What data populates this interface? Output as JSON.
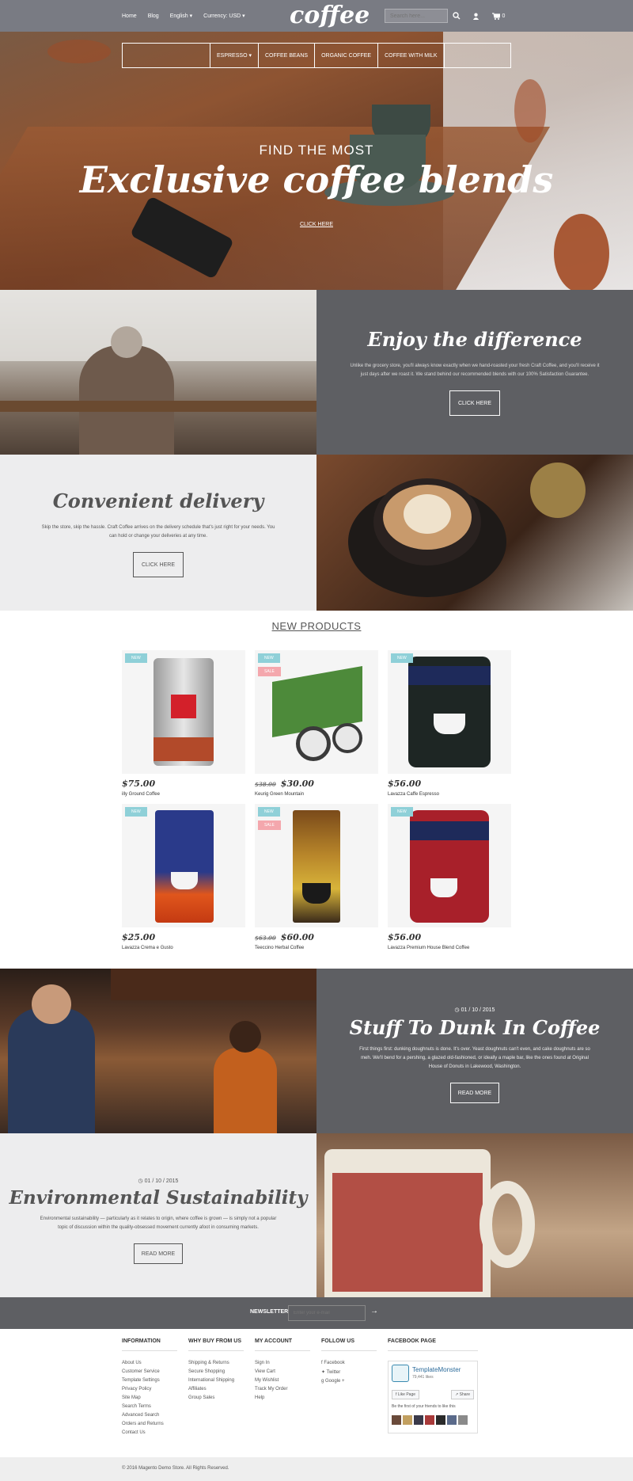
{
  "header": {
    "nav": [
      "Home",
      "Blog",
      "English",
      "Currency: USD"
    ],
    "logo": "coffee",
    "search_placeholder": "Search here...",
    "cart_count": "0"
  },
  "menu": [
    "ESPRESSO",
    "COFFEE BEANS",
    "ORGANIC COFFEE",
    "COFFEE WITH MILK"
  ],
  "hero": {
    "subtitle": "FIND THE MOST",
    "title": "Exclusive coffee blends",
    "link": "CLICK HERE"
  },
  "enjoy": {
    "title": "Enjoy the difference",
    "text": "Unlike the grocery store, you'll always know exactly when we hand-roasted your fresh Craft Coffee, and you'll receive it just days after we roast it. We stand behind our recommended blends with our 100% Satisfaction Guarantee.",
    "button": "CLICK HERE"
  },
  "delivery": {
    "title": "Convenient delivery",
    "text": "Skip the store, skip the hassle. Craft Coffee arrives on the delivery schedule that's just right for your needs. You can hold or change your deliveries at any time.",
    "button": "CLICK HERE"
  },
  "products_section": {
    "title": "NEW PRODUCTS",
    "items": [
      {
        "name": "illy Ground Coffee",
        "price": "$75.00",
        "old": "",
        "new": "NEW",
        "sale": ""
      },
      {
        "name": "Keurig Green Mountain",
        "price": "$30.00",
        "old": "$38.00",
        "new": "NEW",
        "sale": "SALE"
      },
      {
        "name": "Lavazza Caffe Espresso",
        "price": "$56.00",
        "old": "",
        "new": "NEW",
        "sale": ""
      },
      {
        "name": "Lavazza Crema e Gusto",
        "price": "$25.00",
        "old": "",
        "new": "NEW",
        "sale": ""
      },
      {
        "name": "Teeccino Herbal Coffee",
        "price": "$60.00",
        "old": "$63.00",
        "new": "NEW",
        "sale": "SALE"
      },
      {
        "name": "Lavazza Premium House Blend Coffee",
        "price": "$56.00",
        "old": "",
        "new": "NEW",
        "sale": ""
      }
    ]
  },
  "post1": {
    "date": "01 / 10 / 2015",
    "title": "Stuff To Dunk In Coffee",
    "text": "First things first: dunking doughnuts is done. It's over. Yeast doughnuts can't even, and cake doughnuts are so meh. We'll bend for a pershing, a glazed old-fashioned, or ideally a maple bar, like the ones found at Original House of Donuts in Lakewood, Washington.",
    "button": "READ MORE"
  },
  "post2": {
    "date": "01 / 10 / 2015",
    "title": "Environmental Sustainability",
    "text": "Environmental sustainability — particularly as it relates to origin, where coffee is grown — is simply not a popular topic of discussion within the quality-obsessed movement currently afoot in consuming markets.",
    "button": "READ MORE"
  },
  "newsletter": {
    "label": "NEWSLETTER",
    "placeholder": "Enter your e-mail"
  },
  "footer": {
    "info": {
      "title": "INFORMATION",
      "links": [
        "About Us",
        "Customer Service",
        "Template Settings",
        "Privacy Policy",
        "Site Map",
        "Search Terms",
        "Advanced Search",
        "Orders and Returns",
        "Contact Us"
      ]
    },
    "why": {
      "title": "WHY BUY FROM US",
      "links": [
        "Shipping & Returns",
        "Secure Shopping",
        "International Shipping",
        "Affiliates",
        "Group Sales"
      ]
    },
    "account": {
      "title": "MY ACCOUNT",
      "links": [
        "Sign In",
        "View Cart",
        "My Wishlist",
        "Track My Order",
        "Help"
      ]
    },
    "follow": {
      "title": "FOLLOW US",
      "links": [
        "Facebook",
        "Twitter",
        "Google +"
      ]
    },
    "facebook": {
      "title": "FACEBOOK PAGE",
      "name": "TemplateMonster",
      "likes": "79,441 likes",
      "like_btn": "Like Page",
      "share_btn": "Share",
      "friends": "Be the first of your friends to like this"
    }
  },
  "copyright": "© 2016 Magento Demo Store. All Rights Reserved."
}
